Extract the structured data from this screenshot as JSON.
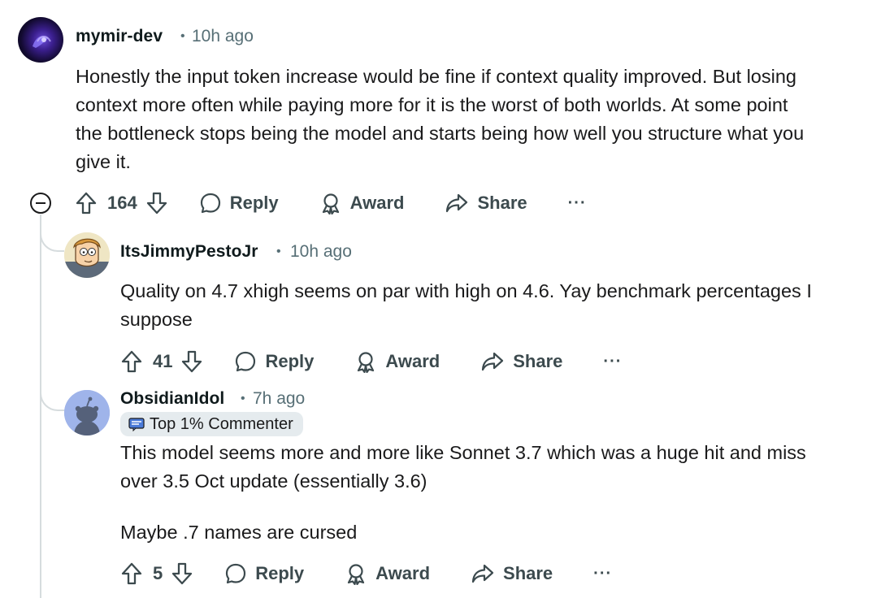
{
  "comments": [
    {
      "author": "mymir-dev",
      "separator": "•",
      "time": "10h ago",
      "body": [
        "Honestly the input token increase would be fine if context quality improved. But losing",
        "context more often while paying more for it is the worst of both worlds. At some point",
        "the bottleneck stops being the model and starts being how well you structure what you",
        "give it."
      ],
      "votes": "164",
      "reply_label": "Reply",
      "award_label": "Award",
      "share_label": "Share",
      "more_label": "···"
    },
    {
      "author": "ItsJimmyPestoJr",
      "separator": "•",
      "time": "10h ago",
      "body": [
        "Quality on 4.7 xhigh seems on par with high on 4.6. Yay benchmark percentages I",
        "suppose"
      ],
      "votes": "41",
      "reply_label": "Reply",
      "award_label": "Award",
      "share_label": "Share",
      "more_label": "···"
    },
    {
      "author": "ObsidianIdol",
      "separator": "•",
      "time": "7h ago",
      "badge": "Top 1% Commenter",
      "body": [
        "This model seems more and more like Sonnet 3.7 which was a huge hit and miss",
        "over 3.5 Oct update (essentially 3.6)",
        "Maybe .7 names are cursed"
      ],
      "votes": "5",
      "reply_label": "Reply",
      "award_label": "Award",
      "share_label": "Share",
      "more_label": "···"
    }
  ],
  "colors": {
    "text": "#1a1a1b",
    "meta": "#576f76",
    "action": "#3c4a4e",
    "thread_line": "#d6dcde",
    "badge_bg": "#e5ebee"
  }
}
